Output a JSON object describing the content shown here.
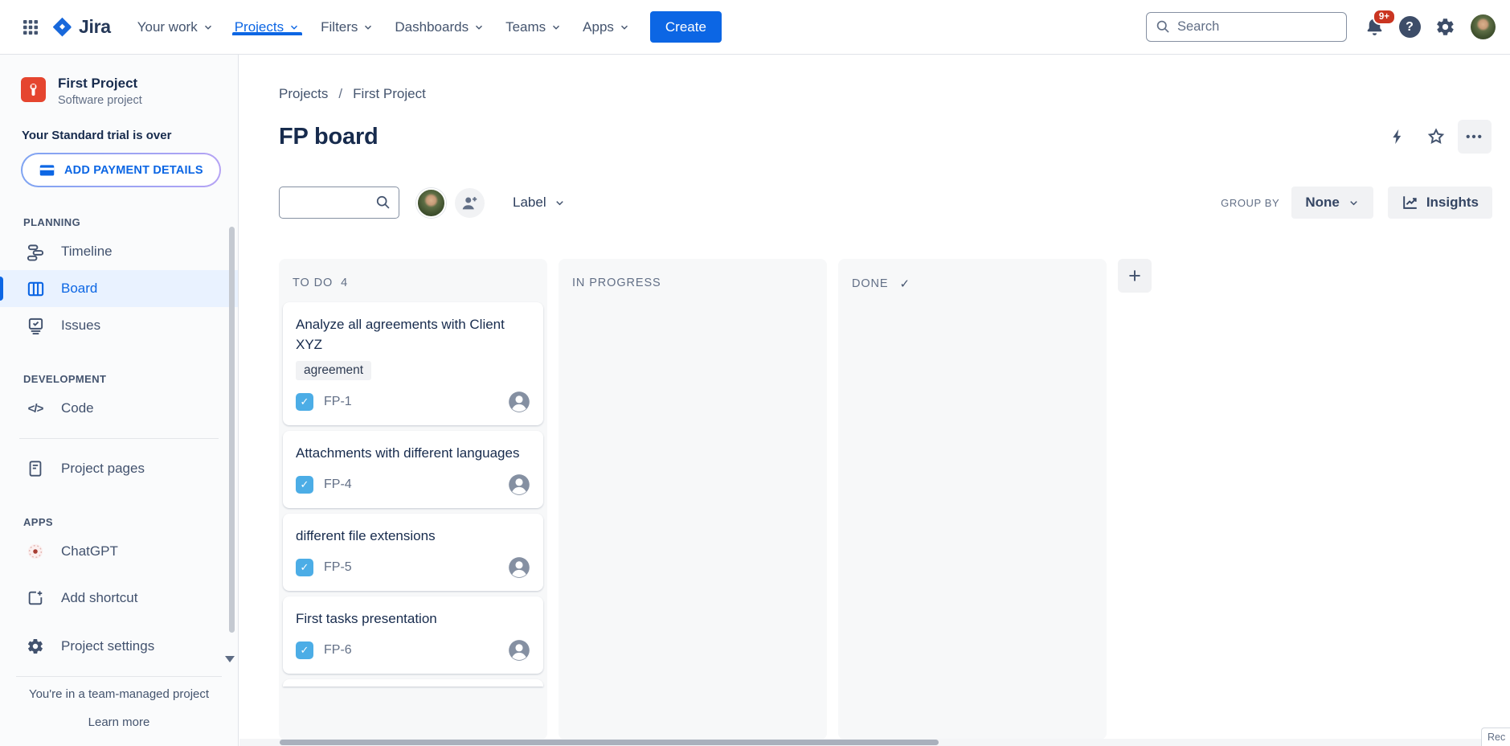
{
  "nav": {
    "logo": "Jira",
    "items": [
      {
        "label": "Your work"
      },
      {
        "label": "Projects"
      },
      {
        "label": "Filters"
      },
      {
        "label": "Dashboards"
      },
      {
        "label": "Teams"
      },
      {
        "label": "Apps"
      }
    ],
    "create_label": "Create",
    "search_placeholder": "Search",
    "notification_badge": "9+",
    "help_glyph": "?"
  },
  "sidebar": {
    "project_name": "First Project",
    "project_type": "Software project",
    "trial_message": "Your Standard trial is over",
    "payment_button": "ADD PAYMENT DETAILS",
    "planning_header": "PLANNING",
    "planning_items": [
      {
        "label": "Timeline"
      },
      {
        "label": "Board"
      },
      {
        "label": "Issues"
      }
    ],
    "development_header": "DEVELOPMENT",
    "development_items": [
      {
        "label": "Code"
      }
    ],
    "code_glyph": "</>",
    "pages_label": "Project pages",
    "apps_header": "APPS",
    "apps_items": [
      {
        "label": "ChatGPT"
      }
    ],
    "add_shortcut": "Add shortcut",
    "project_settings": "Project settings",
    "footer_message": "You're in a team-managed project",
    "footer_link": "Learn more"
  },
  "main": {
    "breadcrumb": {
      "items": [
        {
          "label": "Projects"
        },
        {
          "label": "First Project"
        }
      ],
      "separator": "/"
    },
    "title": "FP board",
    "more_glyph": "•••",
    "filter": {
      "label_dropdown": "Label",
      "group_by": "GROUP BY",
      "group_by_value": "None",
      "insights": "Insights"
    }
  },
  "board": {
    "columns": [
      {
        "name": "TO DO",
        "count": "4"
      },
      {
        "name": "IN PROGRESS"
      },
      {
        "name": "DONE"
      }
    ],
    "check_glyph": "✓",
    "add_column_glyph": "+",
    "cards": [
      {
        "title": "Analyze all agreements with Client XYZ",
        "tag": "agreement",
        "key": "FP-1"
      },
      {
        "title": "Attachments with different languages",
        "key": "FP-4"
      },
      {
        "title": "different file extensions",
        "key": "FP-5"
      },
      {
        "title": "First tasks presentation",
        "key": "FP-6"
      }
    ]
  },
  "scroll": {
    "corner_text": "Rec"
  },
  "colors": {
    "accent": "#0C66E4",
    "badge_red": "#CA3521",
    "task_blue": "#4CADE6",
    "project_orange": "#E5452F",
    "selected_bg": "#E9F2FF"
  }
}
